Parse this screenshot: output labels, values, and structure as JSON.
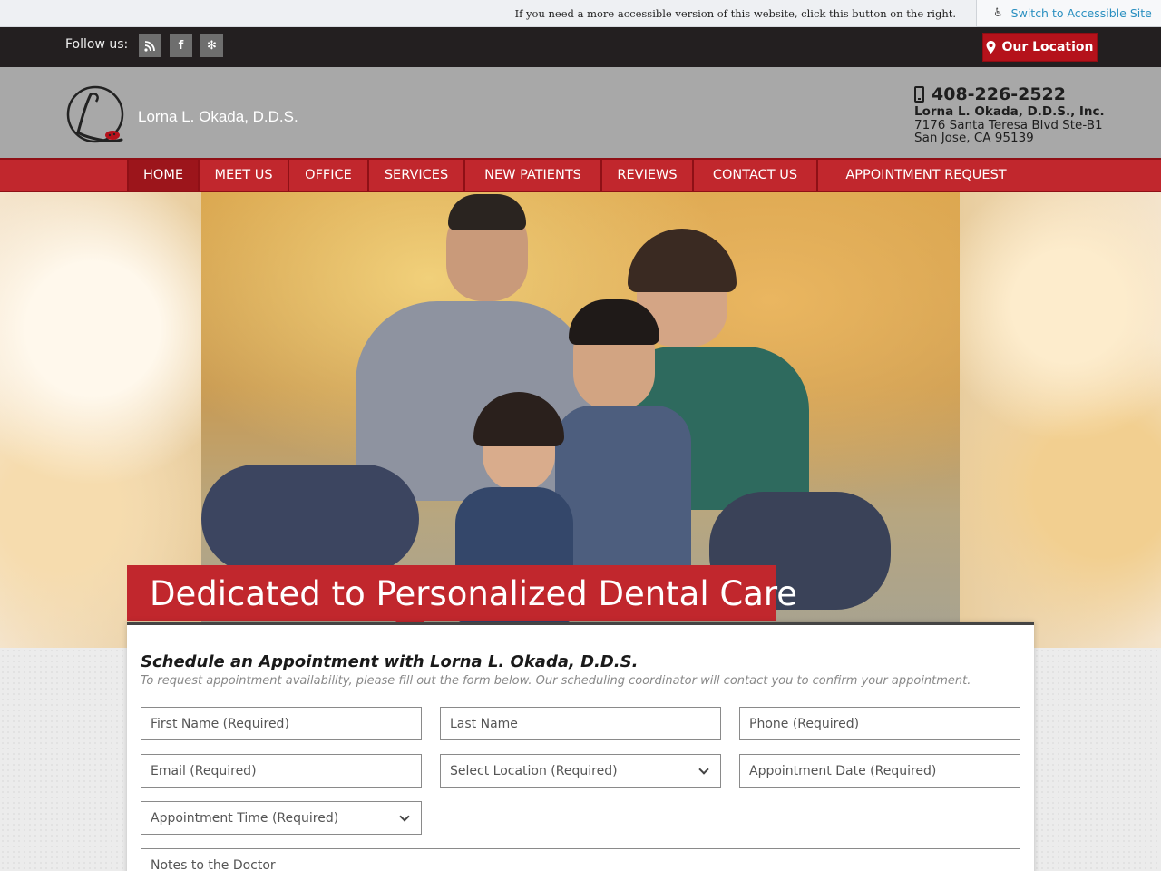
{
  "accessibility": {
    "notice": "If you need a more accessible version of this website, click this button on the right.",
    "button_label": "Switch to Accessible Site",
    "icon": "wheelchair-icon"
  },
  "topbar": {
    "follow_label": "Follow us:",
    "social": [
      {
        "name": "rss-icon",
        "glyph": "⦿"
      },
      {
        "name": "facebook-icon",
        "glyph": "f"
      },
      {
        "name": "yelp-icon",
        "glyph": "✻"
      }
    ],
    "location_button": "Our Location"
  },
  "header": {
    "logo_text": "Lorna L. Okada, D.D.S.",
    "phone": "408-226-2522",
    "business_name": "Lorna L. Okada, D.D.S., Inc.",
    "address_line1": "7176 Santa Teresa Blvd Ste-B1",
    "address_line2": "San Jose, CA 95139"
  },
  "nav": {
    "items": [
      "HOME",
      "MEET US",
      "OFFICE",
      "SERVICES",
      "NEW PATIENTS",
      "REVIEWS",
      "CONTACT US",
      "APPOINTMENT REQUEST"
    ],
    "active": "HOME"
  },
  "hero": {
    "tagline": "Dedicated to Personalized Dental Care"
  },
  "form": {
    "title": "Schedule an Appointment with Lorna L. Okada, D.D.S.",
    "subtitle": "To request appointment availability, please fill out the form below. Our scheduling coordinator will contact you to confirm your appointment.",
    "first_name_placeholder": "First Name (Required)",
    "last_name_placeholder": "Last Name",
    "phone_placeholder": "Phone (Required)",
    "email_placeholder": "Email (Required)",
    "location_select": "Select Location (Required)",
    "date_placeholder": "Appointment Date (Required)",
    "time_select": "Appointment Time (Required)",
    "notes_placeholder": "Notes to the Doctor"
  },
  "colors": {
    "brand_red": "#c1272d",
    "dark_bar": "#231f20",
    "header_gray": "#a8a8a8",
    "link_blue": "#2a8fc0"
  }
}
